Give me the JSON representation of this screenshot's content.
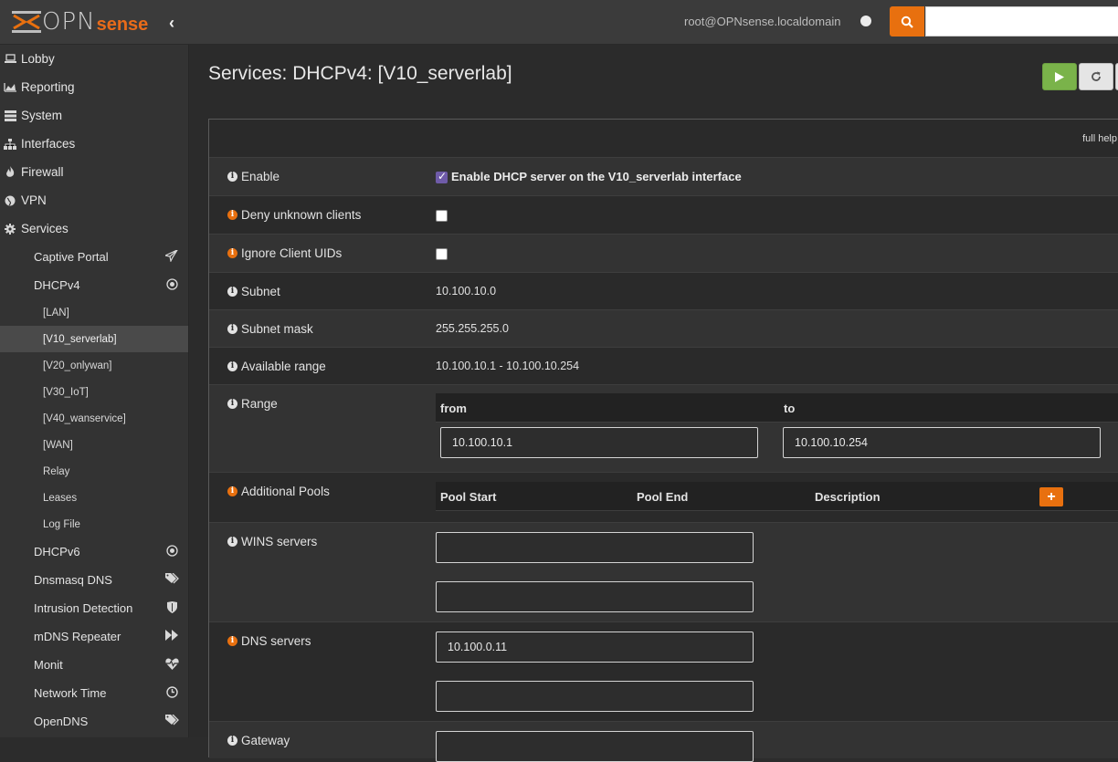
{
  "topbar": {
    "logo_opn": "OPN",
    "logo_sense": "sense",
    "user": "root@OPNsense.localdomain",
    "search_placeholder": ""
  },
  "sidebar": {
    "items": [
      {
        "label": "Lobby",
        "icon": "laptop-icon"
      },
      {
        "label": "Reporting",
        "icon": "area-chart-icon"
      },
      {
        "label": "System",
        "icon": "server-icon"
      },
      {
        "label": "Interfaces",
        "icon": "sitemap-icon"
      },
      {
        "label": "Firewall",
        "icon": "fire-icon"
      },
      {
        "label": "VPN",
        "icon": "globe-icon"
      },
      {
        "label": "Services",
        "icon": "cog-icon"
      }
    ],
    "services_sub": [
      {
        "label": "Captive Portal",
        "icon": "paper-plane-icon"
      },
      {
        "label": "DHCPv4",
        "icon": "bullseye-icon"
      }
    ],
    "dhcpv4_sub": [
      {
        "label": "[LAN]"
      },
      {
        "label": "[V10_serverlab]"
      },
      {
        "label": "[V20_onlywan]"
      },
      {
        "label": "[V30_IoT]"
      },
      {
        "label": "[V40_wanservice]"
      },
      {
        "label": "[WAN]"
      },
      {
        "label": "Relay"
      },
      {
        "label": "Leases"
      },
      {
        "label": "Log File"
      }
    ],
    "services_sub2": [
      {
        "label": "DHCPv6",
        "icon": "bullseye-icon"
      },
      {
        "label": "Dnsmasq DNS",
        "icon": "tags-icon"
      },
      {
        "label": "Intrusion Detection",
        "icon": "shield-icon"
      },
      {
        "label": "mDNS Repeater",
        "icon": "fast-forward-icon"
      },
      {
        "label": "Monit",
        "icon": "heartbeat-icon"
      },
      {
        "label": "Network Time",
        "icon": "clock-icon"
      },
      {
        "label": "OpenDNS",
        "icon": "tags-icon"
      }
    ]
  },
  "main": {
    "title": "Services: DHCPv4: [V10_serverlab]",
    "full_help": "full help",
    "enable_label": "Enable",
    "enable_text": "Enable DHCP server on the V10_serverlab interface",
    "deny_label": "Deny unknown clients",
    "ignore_label": "Ignore Client UIDs",
    "subnet_label": "Subnet",
    "subnet_value": "10.100.10.0",
    "mask_label": "Subnet mask",
    "mask_value": "255.255.255.0",
    "avail_label": "Available range",
    "avail_value": "10.100.10.1 - 10.100.10.254",
    "range_label": "Range",
    "range_from_head": "from",
    "range_to_head": "to",
    "range_from": "10.100.10.1",
    "range_to": "10.100.10.254",
    "pools_label": "Additional Pools",
    "pool_start_head": "Pool Start",
    "pool_end_head": "Pool End",
    "pool_desc_head": "Description",
    "add_symbol": "+",
    "wins_label": "WINS servers",
    "wins_1": "",
    "wins_2": "",
    "dns_label": "DNS servers",
    "dns_1": "10.100.0.11",
    "dns_2": "",
    "gateway_label": "Gateway"
  },
  "colors": {
    "accent": "#e8700f",
    "play_button": "#7ab34a",
    "checkbox_checked": "#6f5ba8"
  }
}
